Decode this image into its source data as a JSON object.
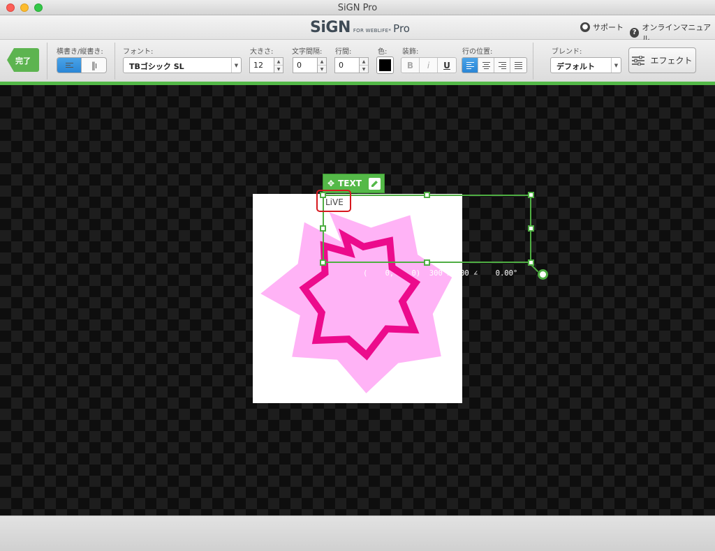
{
  "window": {
    "title": "SiGN Pro"
  },
  "brand": {
    "name": "SiGN",
    "sub": "FOR WEBLIFE*",
    "pro": "Pro"
  },
  "header_links": {
    "support": "サポート",
    "manual": "オンラインマニュアル"
  },
  "toolbar": {
    "done": "完了",
    "orientation_label": "横書き/縦書き:",
    "font_label": "フォント:",
    "font_value": "TBゴシック SL",
    "size_label": "大きさ:",
    "size_value": "12",
    "spacing_label": "文字間隔:",
    "spacing_value": "0",
    "line_label": "行間:",
    "line_value": "0",
    "color_label": "色:",
    "color_value": "#000000",
    "decoration_label": "装飾:",
    "bold": "B",
    "italic": "i",
    "underline": "U",
    "position_label": "行の位置:",
    "blend_label": "ブレンド:",
    "blend_value": "デフォルト",
    "effect": "エフェクト"
  },
  "canvas": {
    "layer_tab": "TEXT",
    "text_content": "LiVE",
    "coords_readout": "(    0,    0)  300 x 100 ∠    0.00°",
    "colors": {
      "star_outer": "#ffb3f6",
      "star_inner_stroke": "#ec0b8c",
      "selection": "#4fae43"
    }
  }
}
